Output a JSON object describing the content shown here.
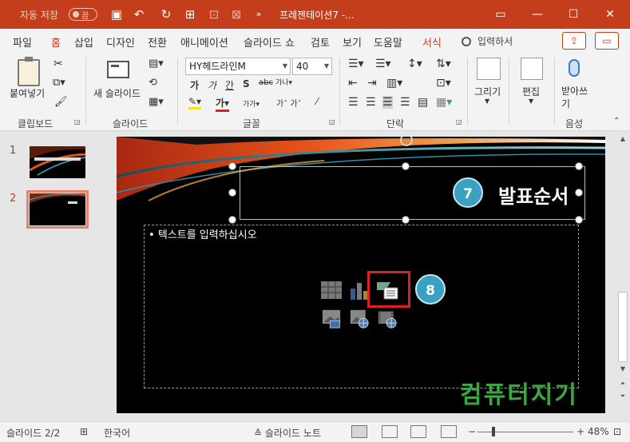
{
  "titlebar": {
    "autosave_label": "자동 저장",
    "autosave_state": "끔",
    "doc_title": "프레젠테이션7  -...",
    "icons": [
      "save-icon",
      "undo-icon",
      "redo-icon",
      "present-icon",
      "qa-icon",
      "select-icon",
      "more-icon"
    ],
    "window_controls": [
      "ribbon-display-icon",
      "minimize-icon",
      "maximize-icon",
      "close-icon"
    ]
  },
  "tabs": [
    "파일",
    "홈",
    "삽입",
    "디자인",
    "전환",
    "애니메이션",
    "슬라이드 쇼",
    "검토",
    "보기",
    "도움말",
    "서식"
  ],
  "active_tab": "홈",
  "search_placeholder": "입력하서",
  "ribbon": {
    "clipboard": {
      "paste": "붙여넣기",
      "group": "클립보드"
    },
    "slides": {
      "new_slide": "새 슬라이드",
      "group": "슬라이드"
    },
    "font": {
      "family": "HY헤드라인M",
      "size": "40",
      "group": "글꼴"
    },
    "paragraph": {
      "group": "단락"
    },
    "drawing": {
      "label": "그리기"
    },
    "editing": {
      "label": "편집"
    },
    "voice": {
      "label": "받아쓰기",
      "group": "음성"
    }
  },
  "thumbnails": [
    {
      "number": "1",
      "selected": false
    },
    {
      "number": "2",
      "selected": true
    }
  ],
  "slide": {
    "title": "발표순서",
    "placeholder_text": "텍스트를 입력하십시오",
    "step_badges": [
      "7",
      "8"
    ],
    "watermark": "컴퓨터지기"
  },
  "status": {
    "slide_pos": "슬라이드 2/2",
    "language": "한국어",
    "notes": "슬라이드 노트",
    "zoom": "48%"
  }
}
